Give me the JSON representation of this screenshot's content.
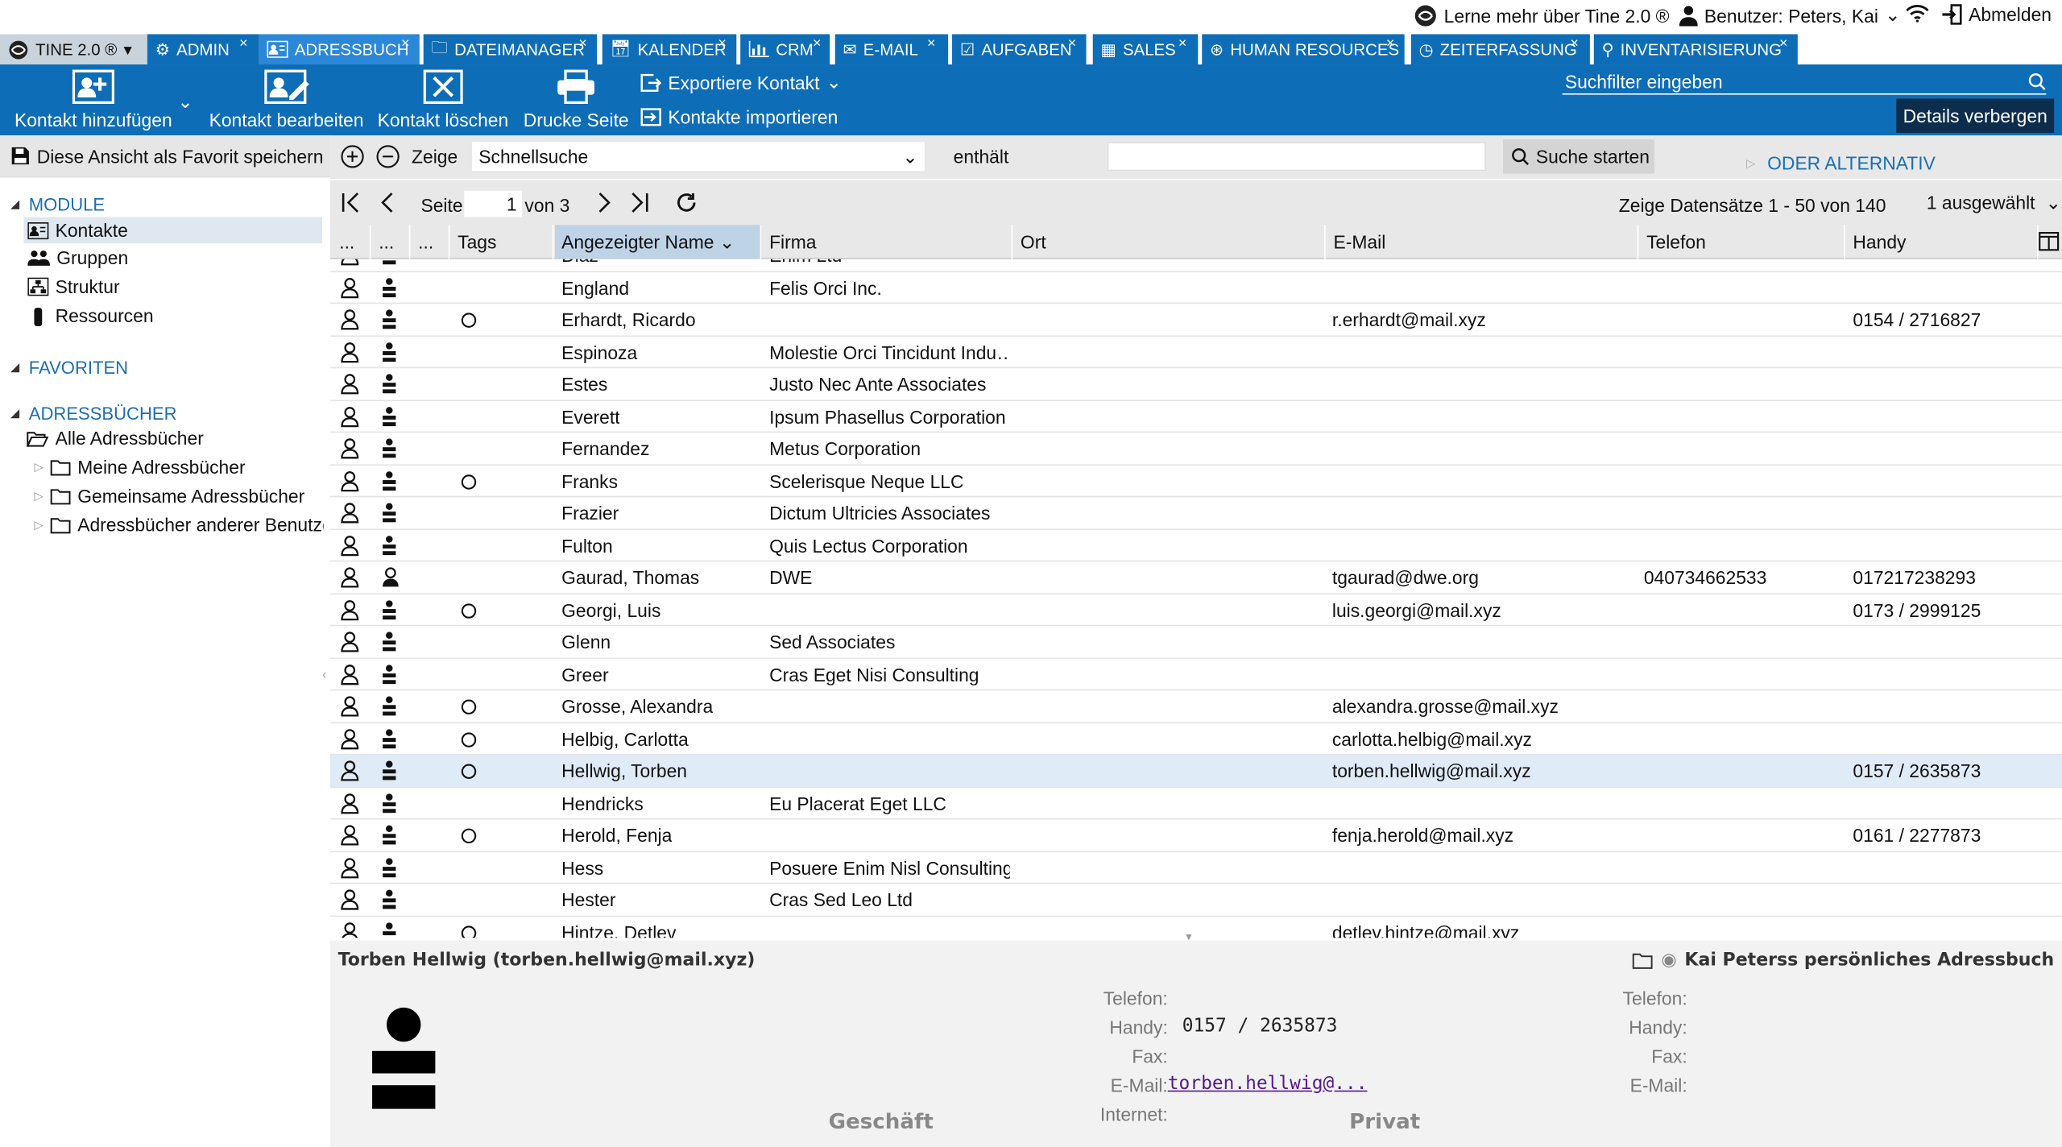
{
  "topbar": {
    "learn_more": "Lerne mehr über Tine 2.0 ®",
    "user": "Benutzer: Peters, Kai",
    "logout": "Abmelden"
  },
  "tabs": [
    {
      "label": "TINE 2.0 ®"
    },
    {
      "label": "ADMIN"
    },
    {
      "label": "ADRESSBUCH"
    },
    {
      "label": "DATEIMANAGER"
    },
    {
      "label": "KALENDER"
    },
    {
      "label": "CRM"
    },
    {
      "label": "E-MAIL"
    },
    {
      "label": "AUFGABEN"
    },
    {
      "label": "SALES"
    },
    {
      "label": "HUMAN RESOURCES"
    },
    {
      "label": "ZEITERFASSUNG"
    },
    {
      "label": "INVENTARISIERUNG"
    }
  ],
  "toolbar": {
    "add": "Kontakt hinzufügen",
    "edit": "Kontakt bearbeiten",
    "delete": "Kontakt löschen",
    "print": "Drucke Seite",
    "export": "Exportiere Kontakt",
    "import": "Kontakte importieren",
    "search_placeholder": "Suchfilter eingeben",
    "hide_details": "Details verbergen"
  },
  "sidebar": {
    "save_fav": "Diese Ansicht als Favorit speichern",
    "module_title": "MODULE",
    "modules": [
      "Kontakte",
      "Gruppen",
      "Struktur",
      "Ressourcen"
    ],
    "favorites_title": "FAVORITEN",
    "addressbooks_title": "ADRESSBÜCHER",
    "all_books": "Alle Adressbücher",
    "books": [
      "Meine Adressbücher",
      "Gemeinsame Adressbücher",
      "Adressbücher anderer Benutzer"
    ]
  },
  "filter": {
    "show": "Zeige",
    "select": "Schnellsuche",
    "op": "enthält",
    "search_btn": "Suche starten",
    "or_alt": "ODER ALTERNATIV"
  },
  "pager": {
    "page_label": "Seite",
    "page": "1",
    "of": "von 3",
    "records": "Zeige Datensätze 1 - 50 von 140",
    "selected": "1 ausgewählt"
  },
  "columns": [
    "...",
    "...",
    "...",
    "Tags",
    "Angezeigter Name",
    "Firma",
    "Ort",
    "E-Mail",
    "Telefon",
    "Handy"
  ],
  "rows": [
    {
      "name": "Diaz",
      "firma": "Enim Ltd",
      "email": "",
      "tel": "",
      "handy": "",
      "tag": false
    },
    {
      "name": "England",
      "firma": "Felis Orci Inc.",
      "email": "",
      "tel": "",
      "handy": "",
      "tag": false
    },
    {
      "name": "Erhardt, Ricardo",
      "firma": "",
      "email": "r.erhardt@mail.xyz",
      "tel": "",
      "handy": "0154 / 2716827",
      "tag": true
    },
    {
      "name": "Espinoza",
      "firma": "Molestie Orci Tincidunt Indu…",
      "email": "",
      "tel": "",
      "handy": "",
      "tag": false
    },
    {
      "name": "Estes",
      "firma": "Justo Nec Ante Associates",
      "email": "",
      "tel": "",
      "handy": "",
      "tag": false
    },
    {
      "name": "Everett",
      "firma": "Ipsum Phasellus Corporation",
      "email": "",
      "tel": "",
      "handy": "",
      "tag": false
    },
    {
      "name": "Fernandez",
      "firma": "Metus Corporation",
      "email": "",
      "tel": "",
      "handy": "",
      "tag": false
    },
    {
      "name": "Franks",
      "firma": "Scelerisque Neque LLC",
      "email": "",
      "tel": "",
      "handy": "",
      "tag": true
    },
    {
      "name": "Frazier",
      "firma": "Dictum Ultricies Associates",
      "email": "",
      "tel": "",
      "handy": "",
      "tag": false
    },
    {
      "name": "Fulton",
      "firma": "Quis Lectus Corporation",
      "email": "",
      "tel": "",
      "handy": "",
      "tag": false
    },
    {
      "name": "Gaurad, Thomas",
      "firma": "DWE",
      "email": "tgaurad@dwe.org",
      "tel": "040734662533",
      "handy": "017217238293",
      "tag": false
    },
    {
      "name": "Georgi, Luis",
      "firma": "",
      "email": "luis.georgi@mail.xyz",
      "tel": "",
      "handy": "0173 / 2999125",
      "tag": true
    },
    {
      "name": "Glenn",
      "firma": "Sed Associates",
      "email": "",
      "tel": "",
      "handy": "",
      "tag": false
    },
    {
      "name": "Greer",
      "firma": "Cras Eget Nisi Consulting",
      "email": "",
      "tel": "",
      "handy": "",
      "tag": false
    },
    {
      "name": "Grosse, Alexandra",
      "firma": "",
      "email": "alexandra.grosse@mail.xyz",
      "tel": "",
      "handy": "",
      "tag": true
    },
    {
      "name": "Helbig, Carlotta",
      "firma": "",
      "email": "carlotta.helbig@mail.xyz",
      "tel": "",
      "handy": "",
      "tag": true
    },
    {
      "name": "Hellwig, Torben",
      "firma": "",
      "email": "torben.hellwig@mail.xyz",
      "tel": "",
      "handy": "0157 / 2635873",
      "tag": true
    },
    {
      "name": "Hendricks",
      "firma": "Eu Placerat Eget LLC",
      "email": "",
      "tel": "",
      "handy": "",
      "tag": false
    },
    {
      "name": "Herold, Fenja",
      "firma": "",
      "email": "fenja.herold@mail.xyz",
      "tel": "",
      "handy": "0161 / 2277873",
      "tag": true
    },
    {
      "name": "Hess",
      "firma": "Posuere Enim Nisl Consulting",
      "email": "",
      "tel": "",
      "handy": "",
      "tag": false
    },
    {
      "name": "Hester",
      "firma": "Cras Sed Leo Ltd",
      "email": "",
      "tel": "",
      "handy": "",
      "tag": false
    },
    {
      "name": "Hintze, Detlev",
      "firma": "",
      "email": "detlev.hintze@mail.xyz",
      "tel": "",
      "handy": "",
      "tag": true
    }
  ],
  "details": {
    "title": "Torben Hellwig (torben.hellwig@mail.xyz)",
    "addressbook": "Kai Peterss persönliches Adressbuch",
    "labels": {
      "tel": "Telefon:",
      "handy": "Handy:",
      "fax": "Fax:",
      "email": "E-Mail:",
      "internet": "Internet:"
    },
    "handy": "0157 / 2635873",
    "email": "torben.hellwig@...",
    "business": "Geschäft",
    "private": "Privat"
  },
  "colors": {
    "primary": "#0e6db7",
    "active_tab": "#2b88d8",
    "link": "#1a6fb5"
  }
}
